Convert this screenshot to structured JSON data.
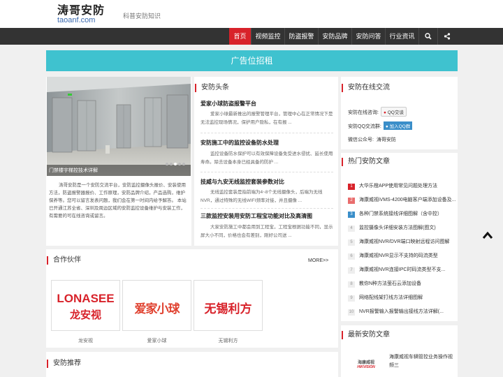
{
  "header": {
    "logo_cn": "涛哥安防",
    "logo_en": "taoanf.com",
    "slogan": "科普安防知识"
  },
  "nav": {
    "items": [
      "首页",
      "视频监控",
      "防盗报警",
      "安防品牌",
      "安防问答",
      "行业资讯"
    ],
    "search_icon": "search-icon",
    "share_icon": "share-icon"
  },
  "ad_bar": "广告位招租",
  "slider": {
    "caption": "门禁楼宇梯控技术详解"
  },
  "intro": "涛哥安防是一个安防交流平台，安防监控摄像头报价、安装使用方法，防盗报警器报价、工作原理，安防品牌介绍，产品选购，维护保养等。您可以留言发表问题，我们会在第一时间内给予解答。 本站已开通江苏全省、深圳及周边区域的安防监控设备维护与安装工作，有需要的可在线咨询或留言。",
  "news": {
    "title": "安防头条",
    "items": [
      {
        "title": "爱家小球防盗报警平台",
        "summary": "爱家小球最新推出的报警管理平台，管理中心在正常情况下是无法监控现场情况，保护用户隐私，在有报 ..."
      },
      {
        "title": "安防施工中的监控设备防水处理",
        "summary": "监控设备防水保护可以有效保障设备免受进水侵扰、延长使用寿命。除去设备本身已经具备的防护 ..."
      },
      {
        "title": "技威与九安无线监控套装参数对比",
        "summary": "无线监控套装是指前端为4~8个无线摄像头，后端为无线NVR，通过特殊的无线WIFI频率对接，并且摄像 ..."
      },
      {
        "title": "三款监控安装用安防工程宝功能对比及高清图",
        "summary": "大家安防施工中都会用到工程宝，工程宝根据功能不同，显示屏大小不同，价格也会有差别，刚好公司送 ..."
      }
    ]
  },
  "contact": {
    "title": "安防在线交流",
    "online_label": "安防在线咨询:",
    "online_badge": "QQ交谈",
    "group_label": "安防QQ交流群:",
    "group_badge": "加入QQ群",
    "wechat_label": "微信公众号:",
    "wechat_value": "涛哥安防"
  },
  "hot": {
    "title": "热门安防文章",
    "items": [
      {
        "rank": "1",
        "text": "大华乐橙APP使用常见问题处理方法"
      },
      {
        "rank": "2",
        "text": "海康威视iVMS-4200电脑客户端添加设备及..."
      },
      {
        "rank": "3",
        "text": "各种门禁系统接线详细图解（含中控）"
      },
      {
        "rank": "4",
        "text": "监控摄像头详细安装方法图解(图文)"
      },
      {
        "rank": "5",
        "text": "海康威视NVR/DVR端口映射远程访问图解"
      },
      {
        "rank": "6",
        "text": "海康威视NVR显示不支持的码流类型"
      },
      {
        "rank": "7",
        "text": "海康威视NVR连接IPC时码流类型不支..."
      },
      {
        "rank": "8",
        "text": "教你N种方法萤石云添加设备"
      },
      {
        "rank": "9",
        "text": "网络配线架打线方法详细图解"
      },
      {
        "rank": "10",
        "text": "NVR报警输入报警输出接线方法详解(..."
      }
    ]
  },
  "latest": {
    "title": "最新安防文章",
    "item_text": "海康威视车辆管控业务操作视频三",
    "item_logo_top": "海康威视",
    "item_logo_bottom": "HIKVISION"
  },
  "partners": {
    "title": "合作伙伴",
    "more": "MORE>>",
    "items": [
      {
        "logo_line1": "LONASEE",
        "logo_line2": "龙安视",
        "name": "龙安视"
      },
      {
        "logo_line1": "爱家小球",
        "name": "爱家小球"
      },
      {
        "logo_line1": "无锡利方",
        "name": "无锡利方"
      }
    ]
  },
  "recommend": {
    "title": "安防推荐"
  },
  "colors": {
    "accent_red": "#d8222a",
    "nav_bg": "#333333",
    "ad_teal": "#3fc2cf"
  }
}
